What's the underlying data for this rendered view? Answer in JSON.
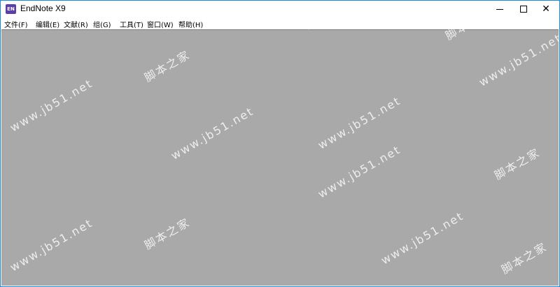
{
  "window": {
    "title": "EndNote X9",
    "app_icon_text": "EN",
    "accent_color": "#1e88d9"
  },
  "menubar": {
    "items": [
      {
        "label": "文件(F)"
      },
      {
        "label": "编辑(E)"
      },
      {
        "label": "文献(R)"
      },
      {
        "label": "组(G)"
      },
      {
        "label": "工具(T)"
      },
      {
        "label": "窗口(W)"
      },
      {
        "label": "帮助(H)"
      }
    ]
  },
  "client_area": {
    "background": "#a9a9a9"
  },
  "watermarks": {
    "site_cn": "脚本之家",
    "site_url": "www.jb51.net"
  },
  "icons": {
    "minimize": "minimize-icon",
    "maximize": "maximize-icon",
    "close": "close-icon"
  }
}
